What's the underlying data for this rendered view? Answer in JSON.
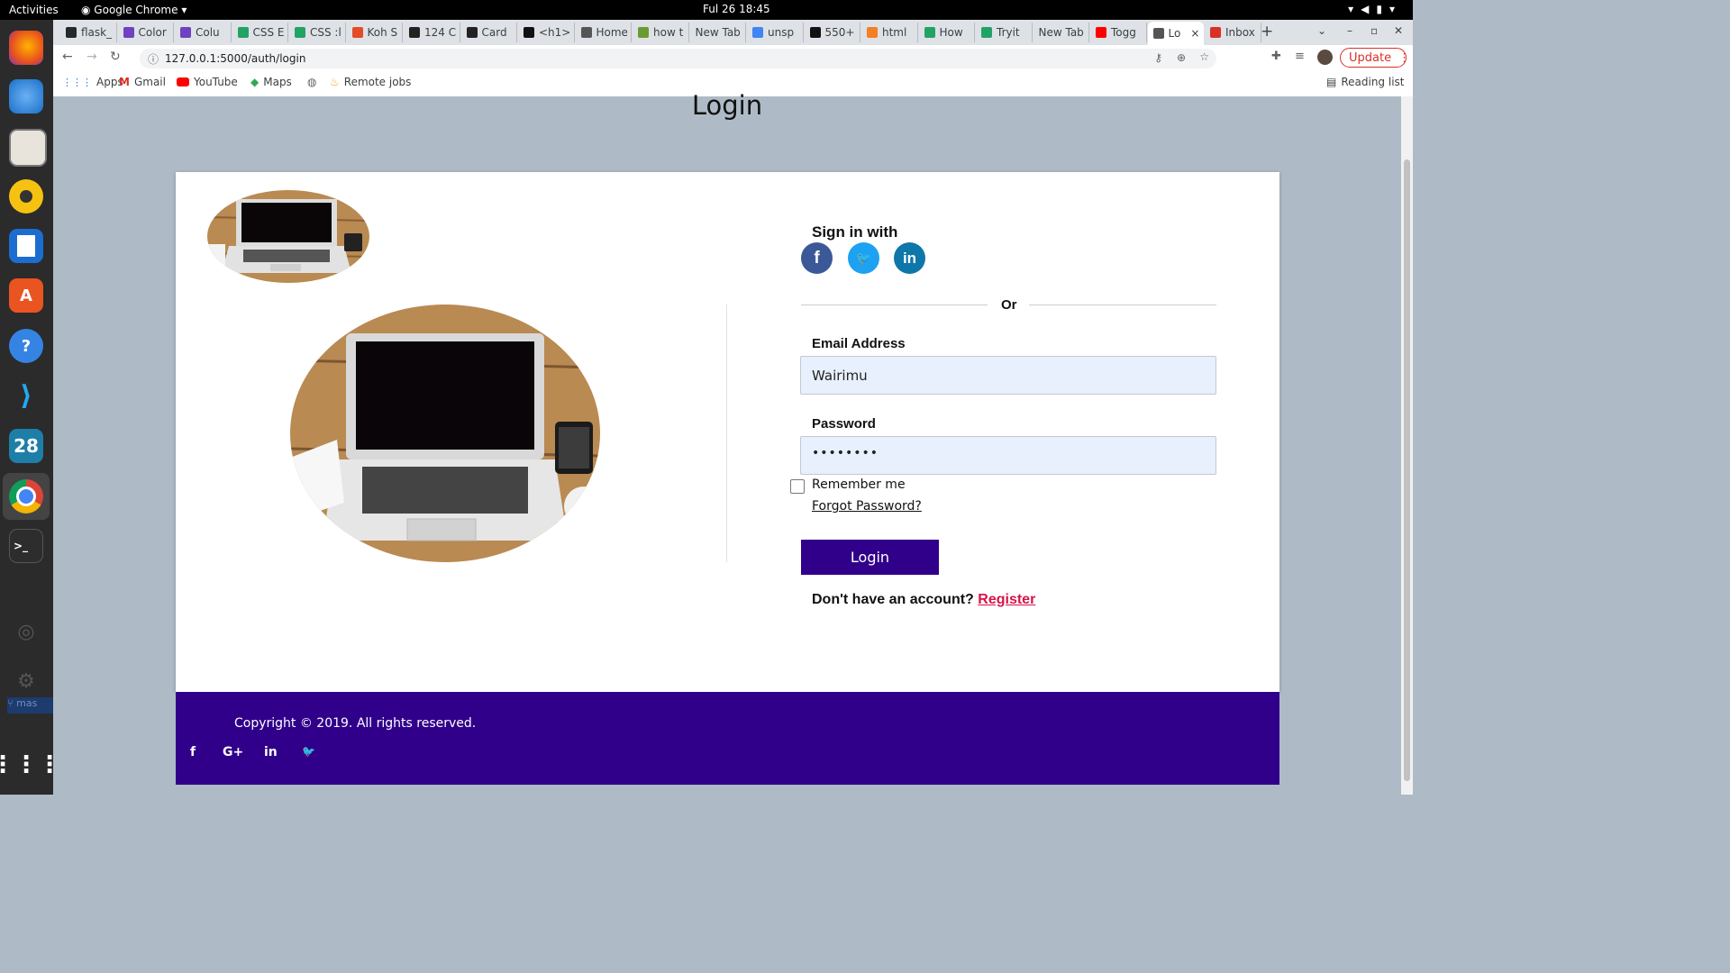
{
  "os": {
    "activities": "Activities",
    "app_name": "Google Chrome",
    "clock": "Ful 26  18:45",
    "dock_items": [
      {
        "name": "firefox",
        "glyph": ""
      },
      {
        "name": "thunderbird",
        "glyph": ""
      },
      {
        "name": "files",
        "glyph": ""
      },
      {
        "name": "rhythmbox",
        "glyph": ""
      },
      {
        "name": "writer",
        "glyph": ""
      },
      {
        "name": "software",
        "glyph": "A"
      },
      {
        "name": "help",
        "glyph": "?"
      },
      {
        "name": "vscode",
        "glyph": ""
      },
      {
        "name": "calendar",
        "glyph": "28"
      },
      {
        "name": "chrome",
        "glyph": ""
      },
      {
        "name": "terminal",
        "glyph": ">_"
      }
    ],
    "dock_branch": "mas"
  },
  "browser": {
    "tabs": [
      {
        "label": "flask_",
        "color": "#24292e"
      },
      {
        "label": "Color",
        "color": "#6f42c1"
      },
      {
        "label": "Colu",
        "color": "#6f42c1"
      },
      {
        "label": "CSS E",
        "color": "#21a366"
      },
      {
        "label": "CSS :l",
        "color": "#21a366"
      },
      {
        "label": "Koh S",
        "color": "#e34c26"
      },
      {
        "label": "124 C",
        "color": "#222"
      },
      {
        "label": "Card",
        "color": "#222"
      },
      {
        "label": "<h1>",
        "color": "#111"
      },
      {
        "label": "Home",
        "color": "#555"
      },
      {
        "label": "how t",
        "color": "#6a9a33"
      },
      {
        "label": "New Tab",
        "color": ""
      },
      {
        "label": "unsp",
        "color": "#4285f4"
      },
      {
        "label": "550+",
        "color": "#111"
      },
      {
        "label": "html",
        "color": "#f48024"
      },
      {
        "label": "How",
        "color": "#21a366"
      },
      {
        "label": "Tryit",
        "color": "#21a366"
      },
      {
        "label": "New Tab",
        "color": ""
      },
      {
        "label": "Togg",
        "color": "#ff0000"
      },
      {
        "label": "Lo",
        "color": "#555"
      },
      {
        "label": "Inbox",
        "color": "#d93025"
      }
    ],
    "active_tab_close": "×",
    "new_tab": "+",
    "url": "127.0.0.1:5000/auth/login",
    "update_label": "Update",
    "bookmarks": [
      "Apps",
      "Gmail",
      "YouTube",
      "Maps",
      "",
      "Remote jobs"
    ],
    "reading_list": "Reading list"
  },
  "page": {
    "title": "Login",
    "sign_in_with": "Sign in with",
    "social_icons": [
      {
        "name": "facebook",
        "glyph": "f",
        "color": "#3b5998"
      },
      {
        "name": "twitter",
        "glyph": "🐦",
        "color": "#1da1f2"
      },
      {
        "name": "linkedin",
        "glyph": "in",
        "color": "#0e76a8"
      }
    ],
    "divider_text": "Or",
    "email_label": "Email Address",
    "email_value": "Wairimu",
    "password_label": "Password",
    "password_value": "••••••••",
    "remember_label": "Remember me",
    "remember_checked": false,
    "forgot_link": "Forgot Password?",
    "login_button": "Login",
    "no_account_text": "Don't have an account?",
    "register_link": "Register",
    "footer": {
      "copyright": "Copyright © 2019. All rights reserved.",
      "social": [
        "f",
        "G+",
        "in",
        "🐦"
      ]
    }
  }
}
